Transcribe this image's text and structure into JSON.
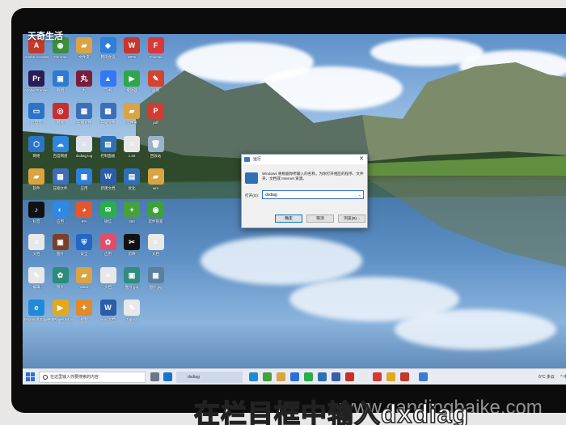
{
  "watermark": {
    "text": "天奇生活"
  },
  "caption": {
    "text": "在栏目框中输入dxdiag",
    "site": "www.candingbaike.com"
  },
  "desktop": {
    "icons": [
      {
        "label": "Adobe Acrobat",
        "color": "#c23a2b",
        "glyph": "A"
      },
      {
        "label": "Chrome",
        "color": "#3b8e3b",
        "glyph": "◉"
      },
      {
        "label": "文件夹",
        "color": "#d9a441",
        "glyph": "▰"
      },
      {
        "label": "腾讯会议",
        "color": "#2d7fd9",
        "glyph": "◆"
      },
      {
        "label": "WPS",
        "color": "#c6372f",
        "glyph": "W"
      },
      {
        "label": "Foxmail",
        "color": "#d7393a",
        "glyph": "F"
      },
      {
        "label": "Adobe Premiere",
        "color": "#2b1d56",
        "glyph": "Pr"
      },
      {
        "label": "截图",
        "color": "#2f7ad3",
        "glyph": "▣"
      },
      {
        "label": "丸",
        "color": "#7a1d3a",
        "glyph": "丸"
      },
      {
        "label": "飞书",
        "color": "#3478f6",
        "glyph": "▲"
      },
      {
        "label": "播放器",
        "color": "#30a64a",
        "glyph": "▶"
      },
      {
        "label": "画图",
        "color": "#d1452f",
        "glyph": "✎"
      },
      {
        "label": "此电脑",
        "color": "#2d73c9",
        "glyph": "▭"
      },
      {
        "label": "网易",
        "color": "#c62f2f",
        "glyph": "◎"
      },
      {
        "label": "压缩文件",
        "color": "#3c6fb7",
        "glyph": "▦"
      },
      {
        "label": "压缩文件",
        "color": "#3c6fb7",
        "glyph": "▦"
      },
      {
        "label": "文件夹",
        "color": "#d9a441",
        "glyph": "▰"
      },
      {
        "label": "pdf",
        "color": "#d23b32",
        "glyph": "P"
      },
      {
        "label": "网络",
        "color": "#2b74c5",
        "glyph": "⬡"
      },
      {
        "label": "百度网盘",
        "color": "#2e86de",
        "glyph": "☁"
      },
      {
        "label": "dxdiag.log",
        "color": "#dde3ea",
        "glyph": "≡"
      },
      {
        "label": "控制面板",
        "color": "#2e6fb5",
        "glyph": "▤"
      },
      {
        "label": "1.txt",
        "color": "#e8e8e8",
        "glyph": "≡"
      },
      {
        "label": "回收站",
        "color": "#9bb3c9",
        "glyph": "🗑"
      },
      {
        "label": "软件",
        "color": "#d9a441",
        "glyph": "▰"
      },
      {
        "label": "压缩文件",
        "color": "#3c6fb7",
        "glyph": "▦"
      },
      {
        "label": "应用",
        "color": "#2d7fd9",
        "glyph": "▦"
      },
      {
        "label": "新建文档",
        "color": "#2a5ea8",
        "glyph": "W"
      },
      {
        "label": "优化",
        "color": "#2e6fb5",
        "glyph": "▤"
      },
      {
        "label": "wm",
        "color": "#d9a441",
        "glyph": "▰"
      },
      {
        "label": "抖音",
        "color": "#111111",
        "glyph": "♪"
      },
      {
        "label": "应用",
        "color": "#2e88e6",
        "glyph": "◐"
      },
      {
        "label": "IPA",
        "color": "#e4572e",
        "glyph": "◕"
      },
      {
        "label": "微信",
        "color": "#2aae4a",
        "glyph": "✉"
      },
      {
        "label": "360",
        "color": "#46a03d",
        "glyph": "+"
      },
      {
        "label": "软件管家",
        "color": "#3f9f3a",
        "glyph": "◉"
      },
      {
        "label": "文档",
        "color": "#e8e8e8",
        "glyph": "≡"
      },
      {
        "label": "图片",
        "color": "#7a3f26",
        "glyph": "▣"
      },
      {
        "label": "安全",
        "color": "#2267c4",
        "glyph": "⛨"
      },
      {
        "label": "应用",
        "color": "#e04f6a",
        "glyph": "✿"
      },
      {
        "label": "剪映",
        "color": "#111111",
        "glyph": "✂"
      },
      {
        "label": "文档",
        "color": "#e8e8e8",
        "glyph": "≡"
      },
      {
        "label": "编辑",
        "color": "#e8e8e8",
        "glyph": "✎"
      },
      {
        "label": "照片",
        "color": "#2a8c7a",
        "glyph": "✿"
      },
      {
        "label": "video",
        "color": "#d9a441",
        "glyph": "▰"
      },
      {
        "label": "文档",
        "color": "#e8e8e8",
        "glyph": "≡"
      },
      {
        "label": "图片.jpg",
        "color": "#2f8c7e",
        "glyph": "▣"
      },
      {
        "label": "图片.jpg",
        "color": "#5a7fa0",
        "glyph": "▣"
      },
      {
        "label": "Microsoft Edge",
        "color": "#1f8bd8",
        "glyph": "e"
      },
      {
        "label": "PotPlayer 64 bit",
        "color": "#e2a81f",
        "glyph": "▶"
      },
      {
        "label": "视频",
        "color": "#e08a2a",
        "glyph": "✦"
      },
      {
        "label": "word文档",
        "color": "#2a5ea8",
        "glyph": "W"
      },
      {
        "label": "Typora",
        "color": "#e8e8e8",
        "glyph": "✎"
      }
    ]
  },
  "run_dialog": {
    "title": "运行",
    "description": "Windows 将根据你所输入的名称，为你打开相应的程序、文件夹、文档或 Internet 资源。",
    "open_label": "打开(O):",
    "input_value": "dxdiag",
    "ok": "确定",
    "cancel": "取消",
    "browse": "浏览(B)..."
  },
  "taskbar": {
    "search_placeholder": "在这里输入你要搜索的内容",
    "running_task": "dxdiag",
    "weather": "6°C 多云",
    "time": "^ 中"
  }
}
